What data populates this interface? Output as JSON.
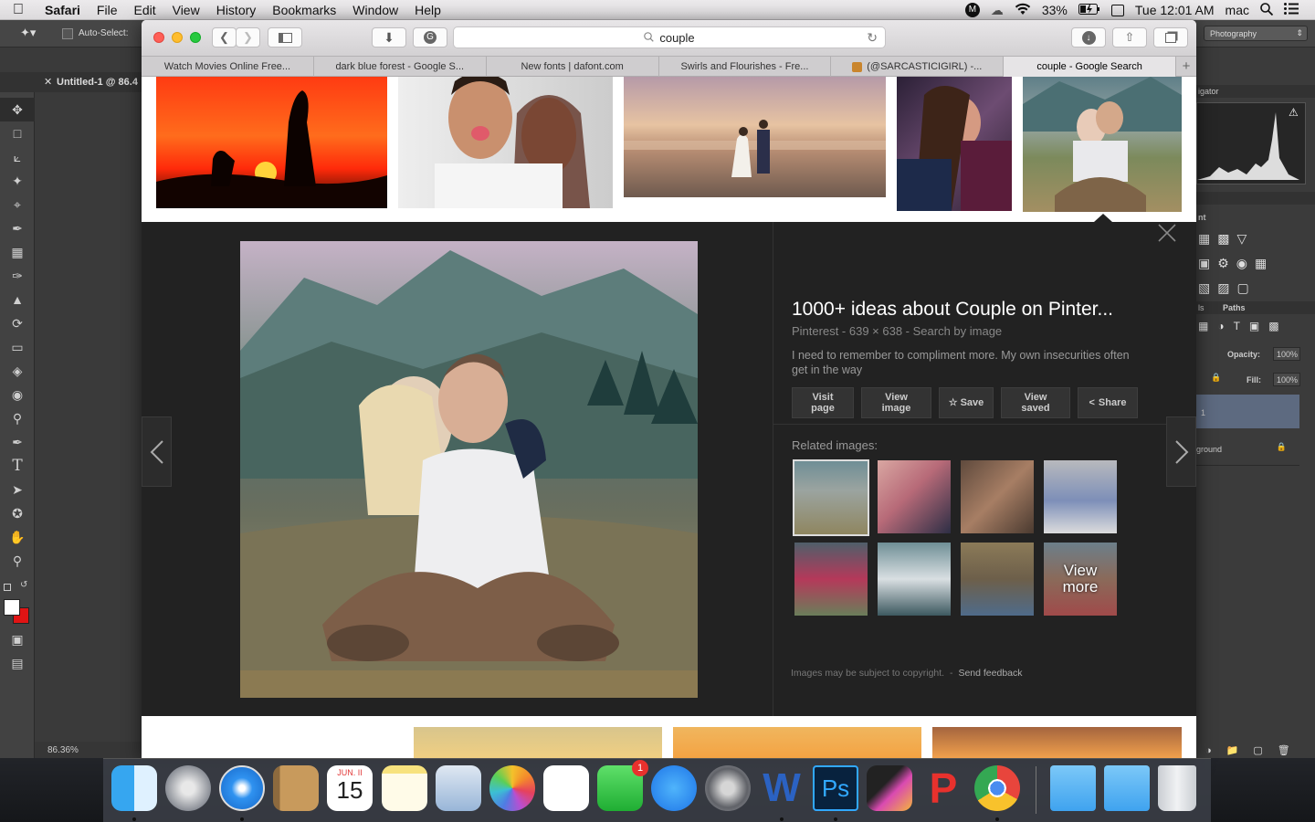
{
  "menubar": {
    "app": "Safari",
    "items": [
      "File",
      "Edit",
      "View",
      "History",
      "Bookmarks",
      "Window",
      "Help"
    ],
    "battery": "33%",
    "clock": "Tue 12:01 AM",
    "user": "mac"
  },
  "photoshop": {
    "auto_select": "Auto-Select:",
    "doc_tab": "Untitled-1 @ 86.4",
    "zoom": "86.36%",
    "workspace": "Photography",
    "navigator": "igator",
    "adjust_label": "nt",
    "paths_tab": "Paths",
    "paths_prefix": "ls",
    "opacity_label": "Opacity:",
    "opacity_value": "100%",
    "fill_label": "Fill:",
    "fill_value": "100%",
    "layer1": "1",
    "layer_bg": "ground"
  },
  "safari": {
    "address": "couple",
    "tabs": [
      {
        "label": "Watch Movies Online Free..."
      },
      {
        "label": "dark blue forest - Google S..."
      },
      {
        "label": "New fonts | dafont.com"
      },
      {
        "label": "Swirls and Flourishes - Fre..."
      },
      {
        "label": "(@SARCASTICIGIRL) -..."
      },
      {
        "label": "couple - Google Search"
      }
    ]
  },
  "preview": {
    "title": "1000+ ideas about Couple on Pinter...",
    "meta": "Pinterest - 639 × 638 - Search by image",
    "description": "I need to remember to compliment more. My own insecurities often get in the way",
    "buttons": {
      "visit": "Visit page",
      "view_image": "View image",
      "save": "Save",
      "view_saved": "View saved",
      "share": "Share"
    },
    "related_label": "Related images:",
    "view_more": "View more",
    "copyright": "Images may be subject to copyright.",
    "separator": "-",
    "feedback": "Send feedback"
  },
  "dock": {
    "calendar_month": "JUN. II",
    "calendar_day": "15",
    "facetime_badge": "1"
  },
  "colors": {
    "panel_bg": "#222222",
    "accent_red": "#ff5f57",
    "accent_yellow": "#ffbd2e",
    "accent_green": "#28c940"
  }
}
